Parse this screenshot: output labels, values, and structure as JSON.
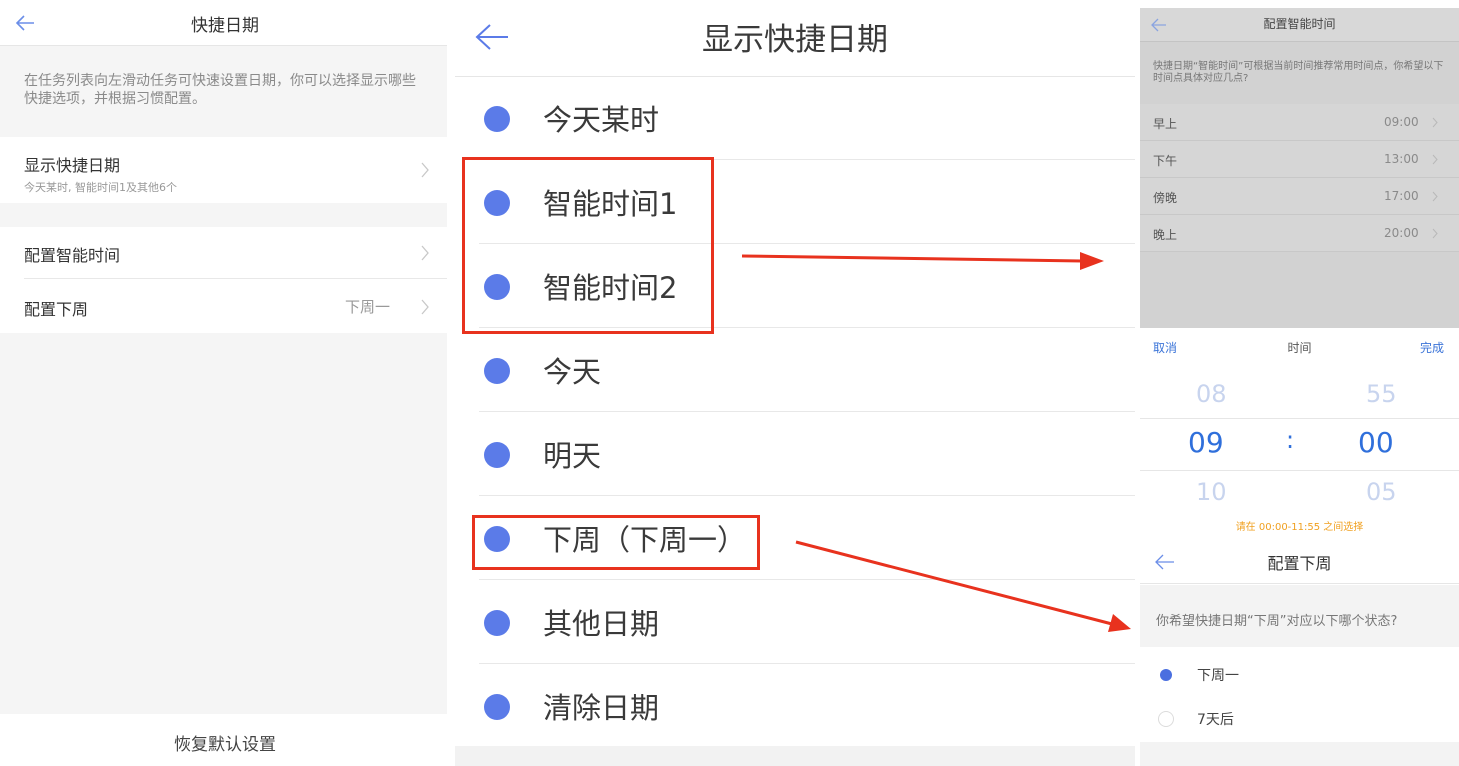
{
  "colors": {
    "accent": "#5b7be8",
    "annotation_red": "#e8321e",
    "hint_orange": "#f0a020",
    "picker_blue": "#2f6fdb"
  },
  "panel1": {
    "title": "快捷日期",
    "back_icon": "arrow-left-icon",
    "description": "在任务列表向左滑动任务可快速设置日期，你可以选择显示哪些快捷选项，并根据习惯配置。",
    "display_row": {
      "label": "显示快捷日期",
      "subtitle": "今天某时, 智能时间1及其他6个"
    },
    "smart_time_row": {
      "label": "配置智能时间"
    },
    "next_week_row": {
      "label": "配置下周",
      "value": "下周一"
    },
    "reset_label": "恢复默认设置"
  },
  "panel2": {
    "title": "显示快捷日期",
    "back_icon": "arrow-left-icon",
    "options": [
      {
        "label": "今天某时"
      },
      {
        "label": "智能时间1"
      },
      {
        "label": "智能时间2"
      },
      {
        "label": "今天"
      },
      {
        "label": "明天"
      },
      {
        "label": "下周（下周一）"
      },
      {
        "label": "其他日期"
      },
      {
        "label": "清除日期"
      }
    ]
  },
  "panel3": {
    "title": "配置智能时间",
    "back_icon": "arrow-left-icon",
    "description": "快捷日期“智能时间”可根据当前时间推荐常用时间点，你希望以下时间点具体对应几点?",
    "slots": [
      {
        "label": "早上",
        "value": "09:00"
      },
      {
        "label": "下午",
        "value": "13:00"
      },
      {
        "label": "傍晚",
        "value": "17:00"
      },
      {
        "label": "晚上",
        "value": "20:00"
      }
    ],
    "picker": {
      "cancel_label": "取消",
      "title": "时间",
      "done_label": "完成",
      "hour_prev": "08",
      "hour": "09",
      "hour_next": "10",
      "separator": ":",
      "minute_prev": "55",
      "minute": "00",
      "minute_next": "05",
      "hint": "请在 00:00-11:55 之间选择"
    }
  },
  "panel4": {
    "title": "配置下周",
    "back_icon": "arrow-left-icon",
    "question": "你希望快捷日期“下周”对应以下哪个状态?",
    "options": [
      {
        "label": "下周一",
        "selected": true
      },
      {
        "label": "7天后",
        "selected": false
      }
    ]
  }
}
